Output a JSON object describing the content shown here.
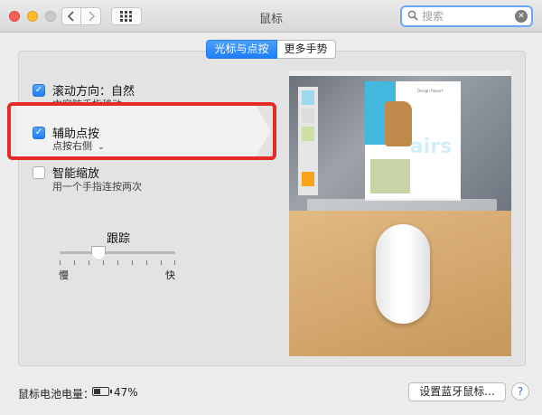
{
  "window": {
    "title": "鼠标"
  },
  "toolbar": {
    "back_icon": "chevron-left-icon",
    "forward_icon": "chevron-right-icon",
    "grid_icon": "grid-icon"
  },
  "search": {
    "placeholder": "搜索",
    "value": ""
  },
  "tabs": [
    {
      "label": "光标与点按",
      "selected": true
    },
    {
      "label": "更多手势",
      "selected": false
    }
  ],
  "options": [
    {
      "title": "滚动方向：自然",
      "subtitle": "内容随手指移动",
      "checked": true
    },
    {
      "title": "辅助点按",
      "subtitle": "点按右侧",
      "checked": true,
      "dropdown": true
    },
    {
      "title": "智能缩放",
      "subtitle": "用一个手指连按两次",
      "checked": false
    }
  ],
  "tracking": {
    "label": "跟踪",
    "min_label": "慢",
    "max_label": "快",
    "level": 0.33
  },
  "battery": {
    "label": "鼠标电池电量：",
    "percent": "47%",
    "level": 0.47
  },
  "buttons": {
    "bluetooth": "设置蓝牙鼠标...",
    "help": "?"
  },
  "preview": {
    "doc_title": "Design Report",
    "doc_hero_text": "airs"
  },
  "colors": {
    "accent": "#1d7ff9",
    "highlight": "#e42b25"
  }
}
